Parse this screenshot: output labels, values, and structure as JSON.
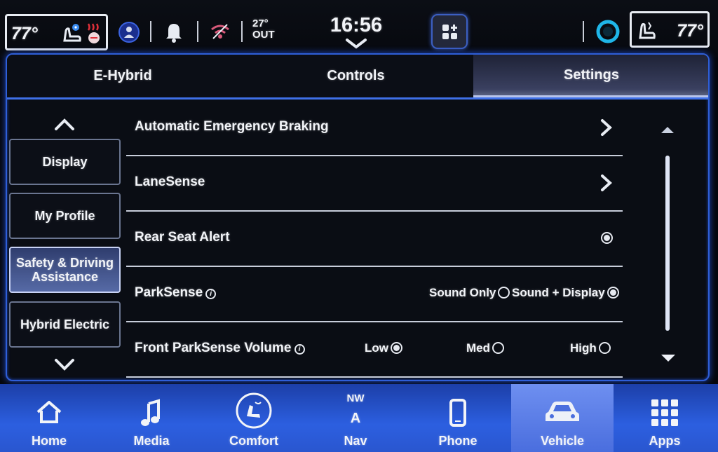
{
  "status": {
    "left_temp": "77°",
    "right_temp": "77°",
    "outside_temp": "27°",
    "outside_label": "OUT",
    "clock": "16:56"
  },
  "tabs": [
    {
      "label": "E-Hybrid",
      "active": false
    },
    {
      "label": "Controls",
      "active": false
    },
    {
      "label": "Settings",
      "active": true
    }
  ],
  "categories": [
    {
      "label": "Display",
      "active": false
    },
    {
      "label": "My Profile",
      "active": false
    },
    {
      "label": "Safety & Driving Assistance",
      "active": true
    },
    {
      "label": "Hybrid Electric",
      "active": false
    }
  ],
  "rows": {
    "aeb": {
      "label": "Automatic Emergency Braking"
    },
    "lanesense": {
      "label": "LaneSense"
    },
    "rear_seat_alert": {
      "label": "Rear Seat Alert",
      "enabled": true
    },
    "parksense": {
      "label": "ParkSense",
      "info_glyph": "i",
      "options": [
        "Sound Only",
        "Sound + Display"
      ],
      "selected": "Sound + Display"
    },
    "front_parksense_volume": {
      "label": "Front ParkSense Volume",
      "info_glyph": "i",
      "options": [
        "Low",
        "Med",
        "High"
      ],
      "selected": "Low"
    }
  },
  "nav": {
    "home": "Home",
    "media": "Media",
    "comfort": "Comfort",
    "nav_heading": "NW",
    "nav_letter": "A",
    "nav": "Nav",
    "phone": "Phone",
    "vehicle": "Vehicle",
    "apps": "Apps",
    "active": "Vehicle"
  },
  "colors": {
    "accent_blue": "#2c5fe0",
    "panel_border": "#2f5fd8",
    "background": "#0a0d14",
    "heated_seat_red": "#e0303a",
    "fan_blue": "#3a8cf0"
  },
  "icons": [
    "seat-fan-icon",
    "heated-seat-icon",
    "driver-profile-icon",
    "bell-icon",
    "wifi-icon",
    "chevron-down-icon",
    "app-drawer-icon",
    "voice-assistant-icon",
    "seat-icon",
    "home-icon",
    "music-icon",
    "climate-icon",
    "phone-icon",
    "car-icon",
    "grid-icon"
  ]
}
